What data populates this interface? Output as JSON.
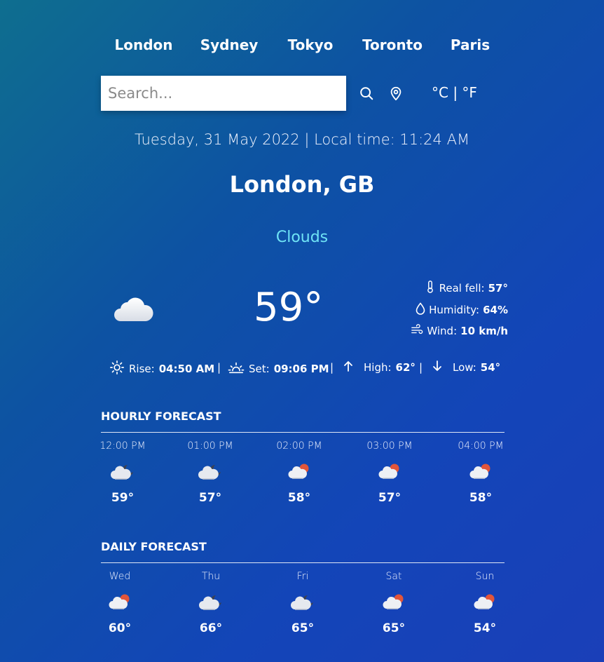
{
  "nav": [
    "London",
    "Sydney",
    "Tokyo",
    "Toronto",
    "Paris"
  ],
  "search": {
    "placeholder": "Search...",
    "value": ""
  },
  "units": {
    "celsius": "°C",
    "separator": " | ",
    "fahrenheit": "°F"
  },
  "date_line": "Tuesday, 31 May 2022 | Local time: 11:24 AM",
  "city": "London, GB",
  "condition": "Clouds",
  "current": {
    "icon": "cloud-icon",
    "temperature": "59°",
    "real_feel_label": "Real fell:",
    "real_feel_value": "57°",
    "humidity_label": "Humidity:",
    "humidity_value": "64%",
    "wind_label": "Wind:",
    "wind_value": "10 km/h"
  },
  "sun": {
    "rise_label": "Rise:",
    "rise_value": "04:50 AM",
    "set_label": "Set:",
    "set_value": "09:06 PM",
    "high_label": "High:",
    "high_value": "62°",
    "low_label": "Low:",
    "low_value": "54°",
    "separator": "|"
  },
  "hourly": {
    "title": "HOURLY FORECAST",
    "items": [
      {
        "time": "12:00 PM",
        "icon": "cloud-moon-icon",
        "temp": "59°"
      },
      {
        "time": "01:00 PM",
        "icon": "cloud-moon-icon",
        "temp": "57°"
      },
      {
        "time": "02:00 PM",
        "icon": "cloud-sun-icon",
        "temp": "58°"
      },
      {
        "time": "03:00 PM",
        "icon": "cloud-sun-icon",
        "temp": "57°"
      },
      {
        "time": "04:00 PM",
        "icon": "cloud-sun-icon",
        "temp": "58°"
      }
    ]
  },
  "daily": {
    "title": "DAILY FORECAST",
    "items": [
      {
        "day": "Wed",
        "icon": "cloud-sun-icon",
        "temp": "60°"
      },
      {
        "day": "Thu",
        "icon": "cloud-moon-icon",
        "temp": "66°"
      },
      {
        "day": "Fri",
        "icon": "cloud-moon-icon",
        "temp": "65°"
      },
      {
        "day": "Sat",
        "icon": "cloud-sun-icon",
        "temp": "65°"
      },
      {
        "day": "Sun",
        "icon": "cloud-sun-icon",
        "temp": "54°"
      }
    ]
  },
  "colors": {
    "condition": "#6fe3f5",
    "sun_badge": "#e2553a"
  }
}
